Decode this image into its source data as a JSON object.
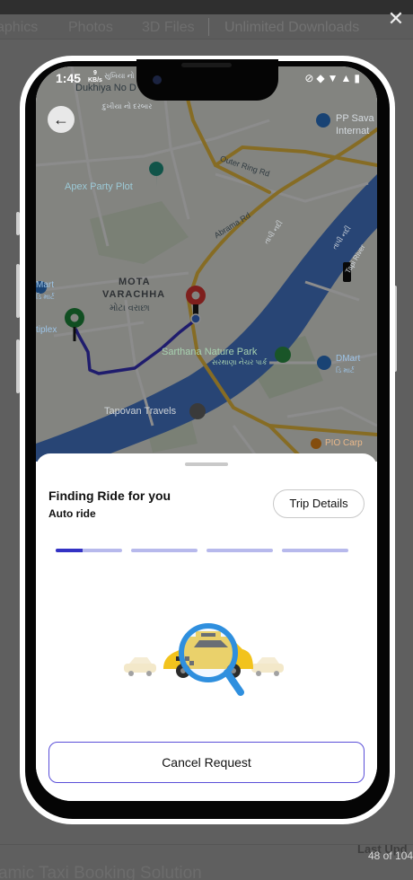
{
  "background_page": {
    "nav_items": [
      "aphics",
      "Photos",
      "3D Files",
      "Unlimited Downloads"
    ],
    "bottom_title": "amic Taxi Booking Solution",
    "last_label": "Last Upd",
    "counter": "48 of 104"
  },
  "status_bar": {
    "time": "1:45",
    "speed_value": "9",
    "speed_unit": "KB/s"
  },
  "map": {
    "labels": {
      "dukhiya_no": "Dukhiya No D",
      "dukhiya_gu_1": "સુખિયા નો",
      "dukhiya_gu_2": "દુખીયા નો દરબાર",
      "pp_savani_1": "PP Sava",
      "pp_savani_2": "Internat",
      "outer_ring_rd": "Outer Ring Rd",
      "apex_party_plot": "Apex Party Plot",
      "abrama_rd": "Abrama Rd",
      "tapi_gu": "તાપી નદી",
      "tapi_gu_2": "તાપી નદી",
      "tapi_river": "Tapi River",
      "mota_varachha_1": "MOTA",
      "mota_varachha_2": "VARACHHA",
      "mota_varachha_gu": "મોટા વરાછા",
      "dmart_left_1": "Mart",
      "dmart_left_2": "ડિ માર્ટ",
      "multiplex": "tiplex",
      "sarthana_park_1": "Sarthana Nature Park",
      "sarthana_park_2": "સરથાણા નેચર પાર્ક",
      "dmart_right_1": "DMart",
      "dmart_right_2": "ડિ માર્ટ",
      "tapovan_travels": "Tapovan Travels",
      "pio_carp": "PIO Carp"
    },
    "colors": {
      "route": "#3a33c6",
      "river": "#4a7fd6",
      "pickup_pin": "#1e8f3c",
      "drop_pin": "#e53935"
    }
  },
  "sheet": {
    "title": "Finding Ride for you",
    "subtitle": "Auto ride",
    "trip_details_label": "Trip Details",
    "progress": {
      "segments": 4,
      "first_segment_fill": 0.4
    },
    "cancel_label": "Cancel Request",
    "accent": "#3332c4"
  }
}
